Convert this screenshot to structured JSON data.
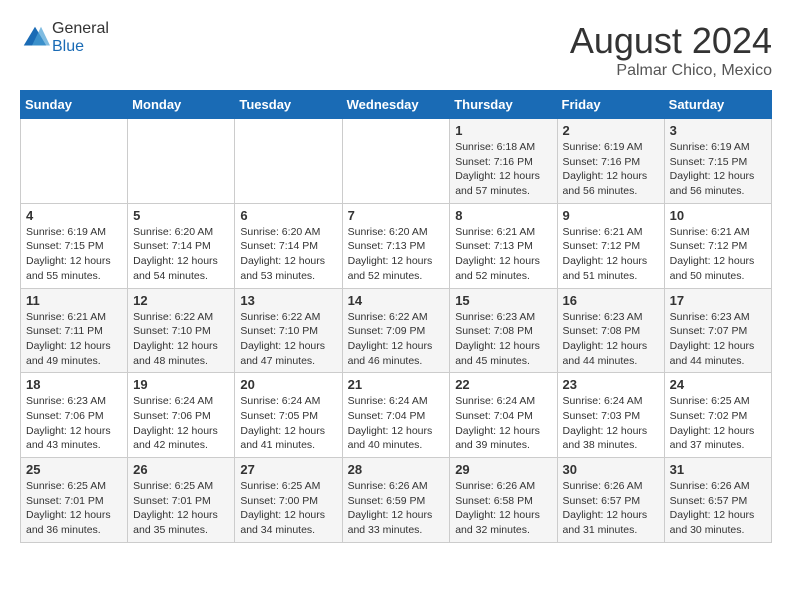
{
  "header": {
    "logo_general": "General",
    "logo_blue": "Blue",
    "month_year": "August 2024",
    "location": "Palmar Chico, Mexico"
  },
  "days_of_week": [
    "Sunday",
    "Monday",
    "Tuesday",
    "Wednesday",
    "Thursday",
    "Friday",
    "Saturday"
  ],
  "weeks": [
    [
      {
        "day": "",
        "info": ""
      },
      {
        "day": "",
        "info": ""
      },
      {
        "day": "",
        "info": ""
      },
      {
        "day": "",
        "info": ""
      },
      {
        "day": "1",
        "info": "Sunrise: 6:18 AM\nSunset: 7:16 PM\nDaylight: 12 hours\nand 57 minutes."
      },
      {
        "day": "2",
        "info": "Sunrise: 6:19 AM\nSunset: 7:16 PM\nDaylight: 12 hours\nand 56 minutes."
      },
      {
        "day": "3",
        "info": "Sunrise: 6:19 AM\nSunset: 7:15 PM\nDaylight: 12 hours\nand 56 minutes."
      }
    ],
    [
      {
        "day": "4",
        "info": "Sunrise: 6:19 AM\nSunset: 7:15 PM\nDaylight: 12 hours\nand 55 minutes."
      },
      {
        "day": "5",
        "info": "Sunrise: 6:20 AM\nSunset: 7:14 PM\nDaylight: 12 hours\nand 54 minutes."
      },
      {
        "day": "6",
        "info": "Sunrise: 6:20 AM\nSunset: 7:14 PM\nDaylight: 12 hours\nand 53 minutes."
      },
      {
        "day": "7",
        "info": "Sunrise: 6:20 AM\nSunset: 7:13 PM\nDaylight: 12 hours\nand 52 minutes."
      },
      {
        "day": "8",
        "info": "Sunrise: 6:21 AM\nSunset: 7:13 PM\nDaylight: 12 hours\nand 52 minutes."
      },
      {
        "day": "9",
        "info": "Sunrise: 6:21 AM\nSunset: 7:12 PM\nDaylight: 12 hours\nand 51 minutes."
      },
      {
        "day": "10",
        "info": "Sunrise: 6:21 AM\nSunset: 7:12 PM\nDaylight: 12 hours\nand 50 minutes."
      }
    ],
    [
      {
        "day": "11",
        "info": "Sunrise: 6:21 AM\nSunset: 7:11 PM\nDaylight: 12 hours\nand 49 minutes."
      },
      {
        "day": "12",
        "info": "Sunrise: 6:22 AM\nSunset: 7:10 PM\nDaylight: 12 hours\nand 48 minutes."
      },
      {
        "day": "13",
        "info": "Sunrise: 6:22 AM\nSunset: 7:10 PM\nDaylight: 12 hours\nand 47 minutes."
      },
      {
        "day": "14",
        "info": "Sunrise: 6:22 AM\nSunset: 7:09 PM\nDaylight: 12 hours\nand 46 minutes."
      },
      {
        "day": "15",
        "info": "Sunrise: 6:23 AM\nSunset: 7:08 PM\nDaylight: 12 hours\nand 45 minutes."
      },
      {
        "day": "16",
        "info": "Sunrise: 6:23 AM\nSunset: 7:08 PM\nDaylight: 12 hours\nand 44 minutes."
      },
      {
        "day": "17",
        "info": "Sunrise: 6:23 AM\nSunset: 7:07 PM\nDaylight: 12 hours\nand 44 minutes."
      }
    ],
    [
      {
        "day": "18",
        "info": "Sunrise: 6:23 AM\nSunset: 7:06 PM\nDaylight: 12 hours\nand 43 minutes."
      },
      {
        "day": "19",
        "info": "Sunrise: 6:24 AM\nSunset: 7:06 PM\nDaylight: 12 hours\nand 42 minutes."
      },
      {
        "day": "20",
        "info": "Sunrise: 6:24 AM\nSunset: 7:05 PM\nDaylight: 12 hours\nand 41 minutes."
      },
      {
        "day": "21",
        "info": "Sunrise: 6:24 AM\nSunset: 7:04 PM\nDaylight: 12 hours\nand 40 minutes."
      },
      {
        "day": "22",
        "info": "Sunrise: 6:24 AM\nSunset: 7:04 PM\nDaylight: 12 hours\nand 39 minutes."
      },
      {
        "day": "23",
        "info": "Sunrise: 6:24 AM\nSunset: 7:03 PM\nDaylight: 12 hours\nand 38 minutes."
      },
      {
        "day": "24",
        "info": "Sunrise: 6:25 AM\nSunset: 7:02 PM\nDaylight: 12 hours\nand 37 minutes."
      }
    ],
    [
      {
        "day": "25",
        "info": "Sunrise: 6:25 AM\nSunset: 7:01 PM\nDaylight: 12 hours\nand 36 minutes."
      },
      {
        "day": "26",
        "info": "Sunrise: 6:25 AM\nSunset: 7:01 PM\nDaylight: 12 hours\nand 35 minutes."
      },
      {
        "day": "27",
        "info": "Sunrise: 6:25 AM\nSunset: 7:00 PM\nDaylight: 12 hours\nand 34 minutes."
      },
      {
        "day": "28",
        "info": "Sunrise: 6:26 AM\nSunset: 6:59 PM\nDaylight: 12 hours\nand 33 minutes."
      },
      {
        "day": "29",
        "info": "Sunrise: 6:26 AM\nSunset: 6:58 PM\nDaylight: 12 hours\nand 32 minutes."
      },
      {
        "day": "30",
        "info": "Sunrise: 6:26 AM\nSunset: 6:57 PM\nDaylight: 12 hours\nand 31 minutes."
      },
      {
        "day": "31",
        "info": "Sunrise: 6:26 AM\nSunset: 6:57 PM\nDaylight: 12 hours\nand 30 minutes."
      }
    ]
  ]
}
